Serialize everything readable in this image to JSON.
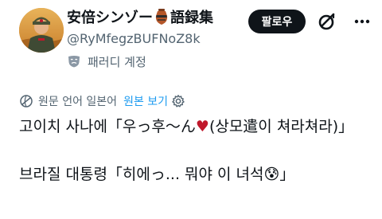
{
  "author": {
    "display_name_part1": "安倍シンゾー",
    "display_name_part2": "語録集",
    "handle": "@RyMfegzBUFNoZ8k",
    "parody_label": "패러디 계정"
  },
  "actions": {
    "follow_label": "팔로우"
  },
  "translation": {
    "notice": "원문 언어 일본어",
    "view_original": "원본 보기"
  },
  "tweet": {
    "line1_before": "고이치 사나에「우っ후〜ん",
    "line1_heart": "♥",
    "line1_after": "(상모遣이 쳐라쳐라)」",
    "line2": "브라질 대통령「히에っ... 뭐야 이 녀석😰」"
  },
  "colors": {
    "accent": "#1d9bf0",
    "text_primary": "#0f1419",
    "text_secondary": "#536471",
    "follow_button_bg": "#0f1419",
    "heart": "#c0182b"
  },
  "icons": {
    "avatar": "avatar-photo",
    "name_badge": "pot-icon",
    "grok": "grok-icon",
    "more": "more-icon",
    "parody": "mask-icon",
    "translate": "globe-icon",
    "settings": "gear-icon"
  }
}
